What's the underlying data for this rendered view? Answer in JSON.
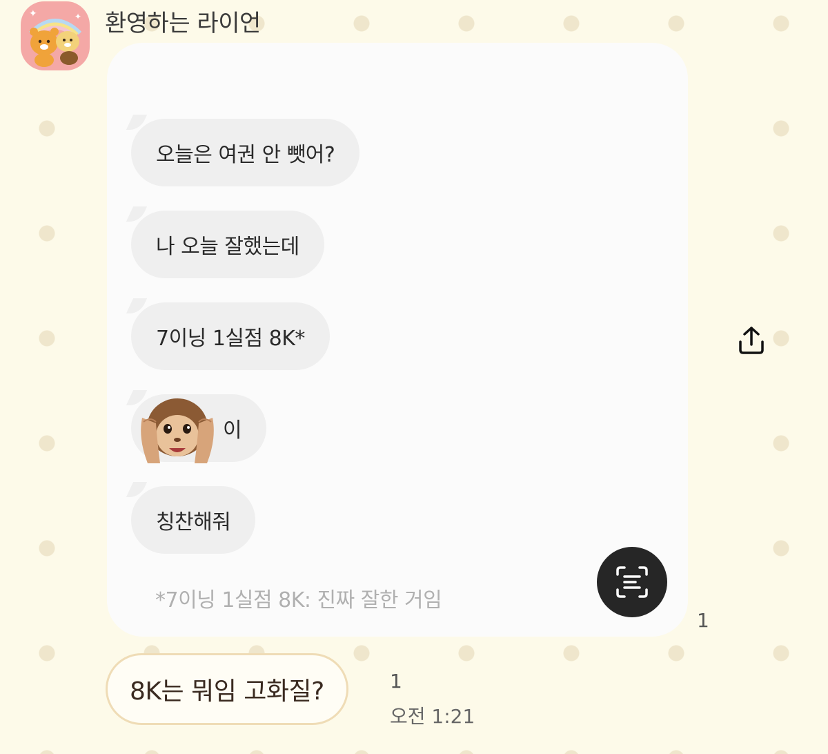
{
  "chat": {
    "sender_name": "환영하는 라이언",
    "image_message": {
      "bubbles": [
        {
          "text": "오늘은 여권 안 뺏어?"
        },
        {
          "text": "나 오늘 잘했는데"
        },
        {
          "text": "7이닝 1실점 8K*"
        },
        {
          "text": "이",
          "emoji": "see-no-evil-monkey"
        },
        {
          "text": "칭찬해줘"
        }
      ],
      "footnote": "*7이닝 1실점 8K: 진짜 잘한 거임"
    },
    "image_read_count": "1",
    "reply": {
      "text": "8K는 뭐임 고화질?",
      "read_count": "1",
      "time": "오전 1:21"
    }
  },
  "icons": {
    "share": "share-icon",
    "text_scan": "text-scan-icon",
    "avatar": "ryan-and-choonsik-avatar"
  },
  "colors": {
    "background": "#fdfae9",
    "dot": "#efe6cc",
    "card": "#fbfbfb",
    "bubble": "#efefef",
    "avatar_bg": "#f4a8a6",
    "scan_button": "#262626",
    "reply_border": "#efdcb6"
  }
}
